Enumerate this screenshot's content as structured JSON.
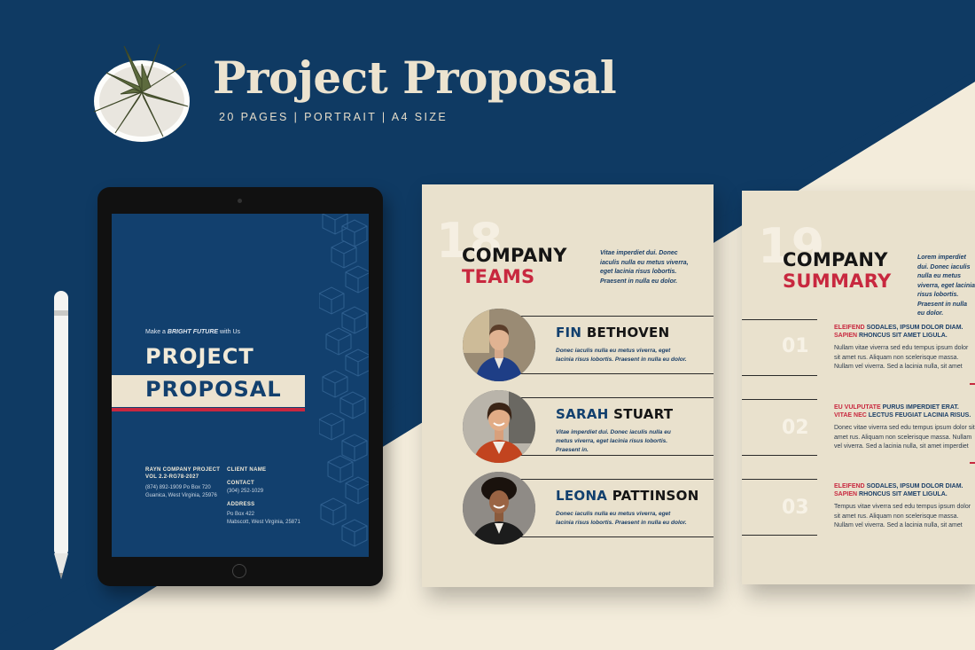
{
  "header": {
    "title": "Project Proposal",
    "subtitle": "20 PAGES | PORTRAIT | A4 SIZE"
  },
  "cover": {
    "tagline_pre": "Make a",
    "tagline_em": "BRIGHT FUTURE",
    "tagline_post": "with Us",
    "title_line1": "PROJECT",
    "title_line2": "PROPOSAL",
    "company_heading": "RAYN COMPANY PROJECT",
    "company_vol": "VOL 2.2-RG78-2027",
    "company_phone": "(874) 892-1909 Po Box 720",
    "company_address": "Guanica, West Virginia, 25976",
    "client_heading": "CLIENT NAME",
    "contact_heading": "CONTACT",
    "contact_phone": "(304) 252-1029",
    "address_heading": "ADDRESS",
    "address_line1": "Po Box 422",
    "address_line2": "Mabscott, West Virginia, 25871"
  },
  "teams_page": {
    "page_number": "18",
    "heading_line1": "COMPANY",
    "heading_line2": "TEAMS",
    "intro": "Vitae imperdiet dui. Donec iaculis nulla eu metus viverra, eget lacinia risus lobortis. Praesent in nulla eu dolor.",
    "members": [
      {
        "first": "FIN",
        "last": "BETHOVEN",
        "desc": "Donec iaculis nulla eu metus viverra, eget lacinia risus lobortis. Praesent in nulla eu dolor."
      },
      {
        "first": "SARAH",
        "last": "STUART",
        "desc": "Vitae imperdiet dui. Donec iaculis nulla eu metus viverra, eget lacinia risus lobortis. Praesent in."
      },
      {
        "first": "LEONA",
        "last": "PATTINSON",
        "desc": "Donec iaculis nulla eu metus viverra, eget lacinia risus lobortis. Praesent in nulla eu dolor."
      }
    ]
  },
  "summary_page": {
    "page_number": "19",
    "heading_line1": "COMPANY",
    "heading_line2": "SUMMARY",
    "intro": "Lorem imperdiet dui. Donec iaculis nulla eu metus viverra, eget lacinia risus lobortis. Praesent in nulla eu dolor.",
    "items": [
      {
        "num": "01",
        "h1_red": "ELEIFEND",
        "h1_blue": "SODALES, IPSUM DOLOR DIAM.",
        "h2_red": "SAPIEN",
        "h2_blue": "RHONCUS SIT AMET LIGULA.",
        "body": "Nullam vitae viverra sed edu tempus ipsum dolor sit amet rus. Aliquam non scelerisque massa. Nullam vel viverra. Sed a lacinia nulla, sit amet imperdiet dui."
      },
      {
        "num": "02",
        "h1_red": "EU VULPUTATE",
        "h1_blue": "PURUS IMPERDIET ERAT.",
        "h2_red": "VITAE NEC",
        "h2_blue": "LECTUS FEUGIAT LACINIA RISUS.",
        "body": "Donec vitae viverra sed edu tempus ipsum dolor sit amet rus. Aliquam non scelerisque massa. Nullam vel viverra. Sed a lacinia nulla, sit amet imperdiet dui."
      },
      {
        "num": "03",
        "h1_red": "ELEIFEND",
        "h1_blue": "SODALES, IPSUM DOLOR DIAM.",
        "h2_red": "SAPIEN",
        "h2_blue": "RHONCUS SIT AMET LIGULA.",
        "body": "Tempus vitae viverra sed edu tempus ipsum dolor sit amet rus. Aliquam non scelerisque massa. Nullam vel viverra. Sed a lacinia nulla, sit amet imperdiet dui."
      }
    ]
  },
  "colors": {
    "navy": "#0f3a63",
    "cream": "#f2ead8",
    "accent_red": "#c8283f"
  },
  "icons": [
    "plant-icon",
    "stylus-icon",
    "hexagon-cube-pattern",
    "camera-icon",
    "home-button-icon"
  ]
}
